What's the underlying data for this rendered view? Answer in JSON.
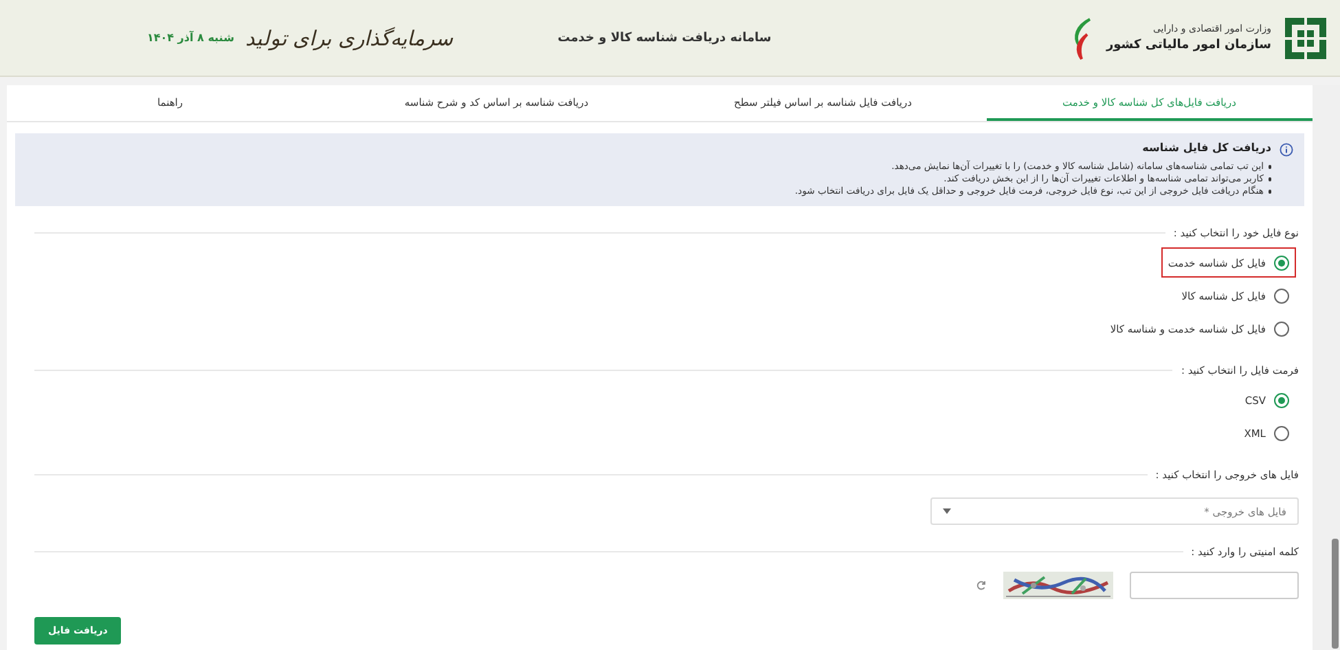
{
  "header": {
    "ministry": "وزارت امور اقتصادی و دارایی",
    "organization": "سازمان امور مالیاتی کشور",
    "title": "سامانه دریافت شناسه کالا و خدمت",
    "slogan": "سرمایه‌گذاری برای تولید",
    "date": "شنبه ۸ آذر ۱۴۰۴"
  },
  "tabs": [
    {
      "label": "دریافت فایل‌های کل شناسه کالا و خدمت",
      "selected": true
    },
    {
      "label": "دریافت فایل شناسه بر اساس فیلتر سطح",
      "selected": false
    },
    {
      "label": "دریافت شناسه بر اساس کد و شرح شناسه",
      "selected": false
    },
    {
      "label": "راهنما",
      "selected": false
    }
  ],
  "info": {
    "title": "دریافت کل فایل شناسه",
    "items": [
      "این تب تمامی شناسه‌های سامانه (شامل شناسه کالا و خدمت) را با تغییرات آن‌ها نمایش می‌دهد.",
      "کاربر می‌تواند تمامی شناسه‌ها و اطلاعات تغییرات آن‌ها را از این بخش دریافت کند.",
      "هنگام دریافت فایل خروجی از این تب، نوع فایل خروجی، فرمت فایل خروجی و حداقل یک فایل برای دریافت انتخاب شود."
    ]
  },
  "sections": [
    {
      "kind": "radio",
      "label": "نوع فایل خود را انتخاب کنید :",
      "options": [
        {
          "label": "فایل کل شناسه خدمت",
          "selected": true,
          "highlighted": true
        },
        {
          "label": "فایل کل شناسه کالا",
          "selected": false,
          "highlighted": false
        },
        {
          "label": "فایل کل شناسه خدمت و شناسه کالا",
          "selected": false,
          "highlighted": false
        }
      ]
    },
    {
      "kind": "radio",
      "label": "فرمت فایل را انتخاب کنید :",
      "options": [
        {
          "label": "CSV",
          "selected": true,
          "highlighted": false
        },
        {
          "label": "XML",
          "selected": false,
          "highlighted": false
        }
      ]
    },
    {
      "kind": "select",
      "label": "فایل های خروجی را انتخاب کنید :",
      "placeholder": "فایل های خروجی *"
    },
    {
      "kind": "captcha",
      "label": "کلمه امنیتی را وارد کنید :"
    }
  ],
  "submit": "دریافت فایل"
}
